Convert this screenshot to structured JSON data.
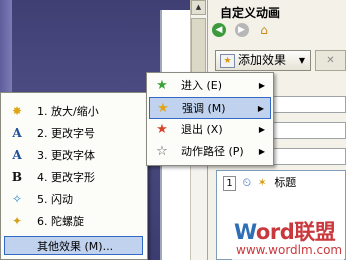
{
  "task_pane": {
    "title": "自定义动画",
    "add_effect_label": "添加效果",
    "remove_icon": "x-icon",
    "animation_item": {
      "order": "1",
      "name": "标题"
    }
  },
  "main_menu": {
    "items": [
      {
        "label": "进入 (E)",
        "icon": "entrance-star-icon"
      },
      {
        "label": "强调 (M)",
        "icon": "emphasis-star-icon"
      },
      {
        "label": "退出 (X)",
        "icon": "exit-star-icon"
      },
      {
        "label": "动作路径 (P)",
        "icon": "motion-path-star-icon"
      }
    ]
  },
  "emphasis_menu": {
    "items": [
      {
        "label": "1. 放大/缩小",
        "icon": "grow-shrink-icon"
      },
      {
        "label": "2. 更改字号",
        "icon": "change-font-size-icon"
      },
      {
        "label": "3. 更改字体",
        "icon": "change-font-icon"
      },
      {
        "label": "4. 更改字形",
        "icon": "change-font-style-icon"
      },
      {
        "label": "5. 闪动",
        "icon": "flicker-icon"
      },
      {
        "label": "6. 陀螺旋",
        "icon": "spin-icon"
      }
    ],
    "more_label": "其他效果 (M)..."
  },
  "watermark": {
    "logo": "Word联盟",
    "url": "www.wordlm.com"
  },
  "colors": {
    "highlight": "#c1d2ee",
    "highlight_border": "#316ac5",
    "watermark": "#c9383c"
  }
}
